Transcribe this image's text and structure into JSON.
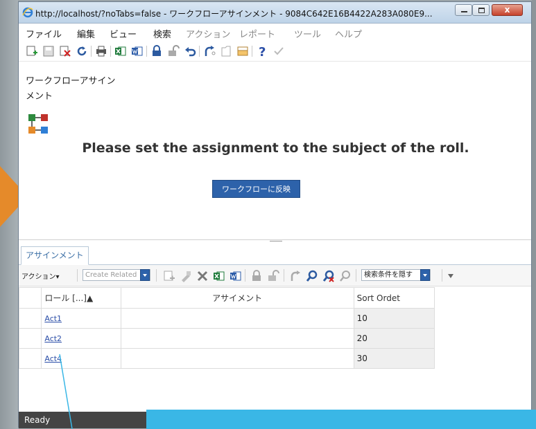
{
  "window": {
    "title": "http://localhost/?noTabs=false - ワークフローアサインメント - 9084C642E16B4422A283A080E9...",
    "close_label": "x"
  },
  "menu": [
    "ファイル",
    "編集",
    "ビュー",
    "検索",
    "アクション",
    "レポート",
    "ツール",
    "ヘルプ"
  ],
  "form": {
    "title": "ワークフローアサインメント",
    "message": "Please set the assignment to the subject of the roll.",
    "reflect_button": "ワークフローに反映"
  },
  "tab": {
    "label": "アサインメント"
  },
  "grid_toolbar": {
    "actions_label": "アクション▾",
    "create_related_placeholder": "Create Related",
    "search_toggle": "検索条件を隠す"
  },
  "table": {
    "headers": [
      "ロール [...]▲",
      "アサイメント",
      "Sort Ordet"
    ],
    "rows": [
      {
        "role": "Act1",
        "assignment": "",
        "sort": "10"
      },
      {
        "role": "Act2",
        "assignment": "",
        "sort": "20"
      },
      {
        "role": "Act4",
        "assignment": "",
        "sort": "30"
      }
    ]
  },
  "status": {
    "text": "Ready"
  },
  "colors": {
    "accent": "#2d62aa",
    "highlight": "#3ab7e6",
    "arrow": "#e58a2a"
  }
}
